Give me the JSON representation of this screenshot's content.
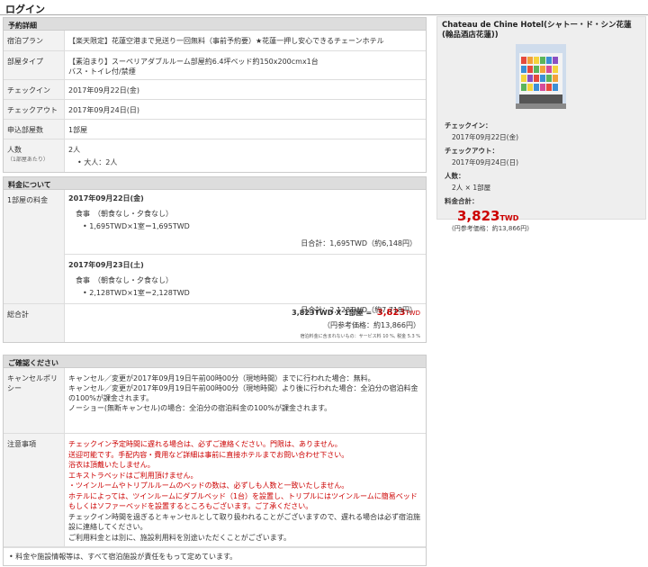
{
  "page": {
    "title": "ログイン"
  },
  "booking": {
    "header": "予約詳細",
    "rows": [
      {
        "label": "宿泊プラン",
        "value": "【楽天限定】花蓮空港まで見送り一回無料（事前予約要）★花蓮一押し安心できるチェーンホテル"
      },
      {
        "label": "部屋タイプ",
        "value": "【素泊まり】スーペリアダブルルーム部屋約6.4坪ベッド約150x200cmx1台",
        "value2": "バス・トイレ付/禁煙"
      },
      {
        "label": "チェックイン",
        "value": "2017年09月22日(金)"
      },
      {
        "label": "チェックアウト",
        "value": "2017年09月24日(日)"
      },
      {
        "label": "申込部屋数",
        "value": "1部屋"
      },
      {
        "label": "人数",
        "sublabel": "（1部屋あたり）",
        "value": "2人",
        "bullet": "大人：2人"
      }
    ]
  },
  "fees": {
    "header": "料金について",
    "row_label": "1部屋の料金",
    "days": [
      {
        "date": "2017年09月22日(金)",
        "meal": "食事　（朝食なし・夕食なし）",
        "price": "1,695TWD×1室＝1,695TWD",
        "total": "日合計：1,695TWD（約6,148円）"
      },
      {
        "date": "2017年09月23日(土)",
        "meal": "食事　（朝食なし・夕食なし）",
        "price": "2,128TWD×1室＝2,128TWD",
        "total": "日合計：2,128TWD（約7,718円）"
      }
    ],
    "grand": {
      "label": "総合計",
      "formula": "3,823TWD X 1部屋 =",
      "amount": "3,823",
      "currency": "TWD",
      "ref": "（円参考価格：約13,866円）",
      "tax": "宿泊料金に含まれないもの：サービス料 10 %, 税金 5.3 %"
    }
  },
  "confirm": {
    "header": "ご確認ください",
    "cancel_label": "キャンセルポリシー",
    "cancel_lines": [
      "キャンセル／変更が2017年09月19日午前00時00分（現地時間）までに行われた場合：無料。",
      "キャンセル／変更が2017年09月19日午前00時00分（現地時間）より後に行われた場合：全泊分の宿泊料金の100%が課金されます。",
      "ノーショー(無断キャンセル)の場合：全泊分の宿泊料金の100%が課金されます。"
    ],
    "notes_label": "注意事項",
    "notes_red": [
      "チェックイン予定時間に遅れる場合は、必ずご連絡ください。門限は、ありません。",
      "送迎可能です。手配内容・費用など詳細は事前に直接ホテルまでお問い合わせ下さい。",
      "浴衣は頂戴いたしません。",
      "エキストラベッドはご利用頂けません。",
      "・ツインルームやトリプルルームのベッドの数は、必ずしも人数と一致いたしません。",
      "ホテルによっては、ツインルームにダブルベッド（1台）を設置し、トリプルにはツインルームに簡易ベッドもしくはソファーベッドを設置するところもございます。ご了承ください。"
    ],
    "notes_black": [
      "チェックイン時間を過ぎるとキャンセルとして取り扱われることがございますので、遅れる場合は必ず宿泊施設に連絡してください。",
      "ご利用料金とは別に、施設利用料を別途いただくことがございます。"
    ],
    "footnote": "料金や施設情報等は、すべて宿泊施設が責任をもって定めています。"
  },
  "summary": {
    "hotel_name": "Chateau de Chine Hotel(シャトー・ド・シン花蓮(翰品酒店花蓮))",
    "checkin_label": "チェックイン：",
    "checkin": "2017年09月22日(金)",
    "checkout_label": "チェックアウト：",
    "checkout": "2017年09月24日(日)",
    "people_label": "人数：",
    "people": "2人 × 1部屋",
    "total_label": "料金合計：",
    "total": "3,823",
    "currency": "TWD",
    "ref": "(円参考価格：約13,866円)"
  }
}
